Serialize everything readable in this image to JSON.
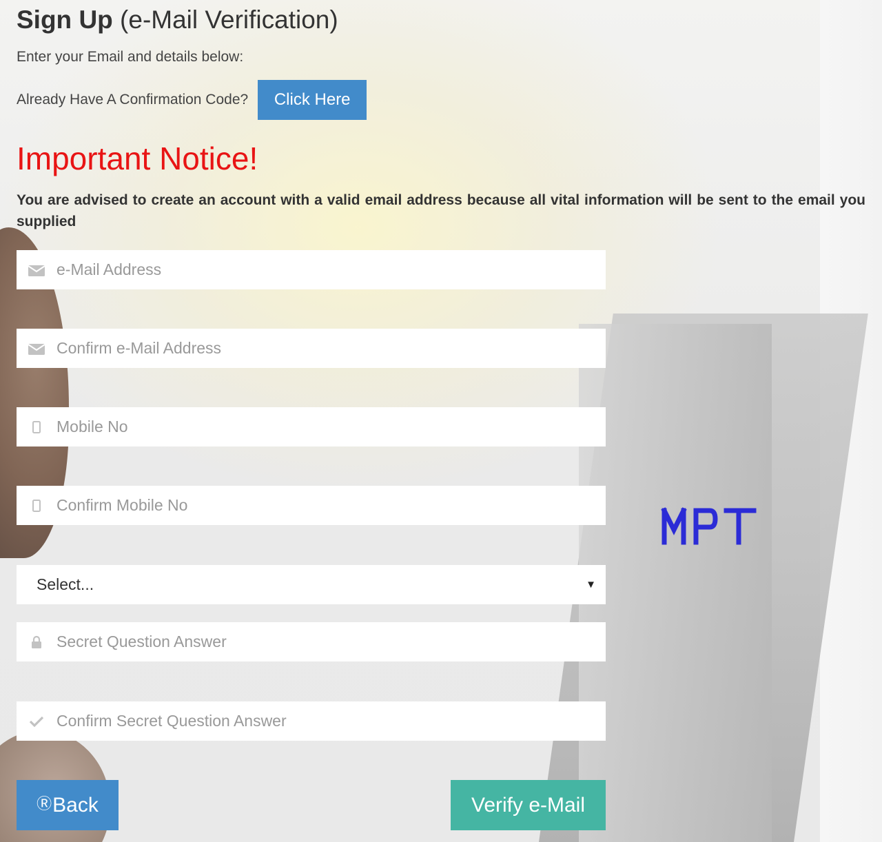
{
  "header": {
    "title_bold": "Sign Up",
    "title_rest": "(e-Mail Verification)",
    "subtitle": "Enter your Email and details below:"
  },
  "confirmation": {
    "label": "Already Have A Confirmation Code?",
    "button": "Click Here"
  },
  "notice": {
    "title": "Important Notice!",
    "text": "You are advised to create an account with a valid email address because all vital information will be sent to the email you supplied"
  },
  "form": {
    "email_placeholder": "e-Mail Address",
    "confirm_email_placeholder": "Confirm e-Mail Address",
    "mobile_placeholder": "Mobile No",
    "confirm_mobile_placeholder": "Confirm Mobile No",
    "secret_question_selected": "Select...",
    "secret_answer_placeholder": "Secret Question Answer",
    "confirm_secret_answer_placeholder": "Confirm Secret Question Answer"
  },
  "captcha": {
    "text": "MPT",
    "color": "#2b2bd6"
  },
  "actions": {
    "back_icon": "back-circle-arrow",
    "back": "Back",
    "verify": "Verify e-Mail"
  },
  "colors": {
    "primary": "#428bca",
    "success": "#45b5a3",
    "notice": "#e81414"
  }
}
